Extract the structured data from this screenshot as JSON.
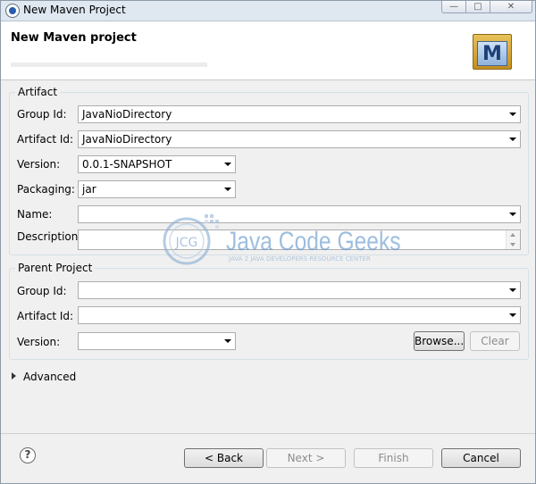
{
  "window": {
    "title": "New Maven Project"
  },
  "banner": {
    "title": "New Maven project",
    "icon_letter": "M"
  },
  "artifact": {
    "legend": "Artifact",
    "group_id": {
      "label": "Group Id:",
      "value": "JavaNioDirectory"
    },
    "artifact_id": {
      "label": "Artifact Id:",
      "value": "JavaNioDirectory"
    },
    "version": {
      "label": "Version:",
      "value": "0.0.1-SNAPSHOT"
    },
    "packaging": {
      "label": "Packaging:",
      "value": "jar"
    },
    "name": {
      "label": "Name:",
      "value": ""
    },
    "description": {
      "label": "Description:",
      "value": ""
    }
  },
  "parent": {
    "legend": "Parent Project",
    "group_id": {
      "label": "Group Id:",
      "value": ""
    },
    "artifact_id": {
      "label": "Artifact Id:",
      "value": ""
    },
    "version": {
      "label": "Version:",
      "value": ""
    },
    "browse_label": "Browse...",
    "clear_label": "Clear"
  },
  "advanced": {
    "label": "Advanced"
  },
  "footer": {
    "help_icon": "?",
    "back_label": "< Back",
    "next_label": "Next >",
    "finish_label": "Finish",
    "cancel_label": "Cancel"
  },
  "watermark": {
    "logo": "JCG",
    "text": "Java Code Geeks",
    "subtext": "JAVA 2 JAVA DEVELOPERS RESOURCE CENTER"
  },
  "colors": {
    "accent": "#2a5cae",
    "watermark": "#6a9ccf"
  }
}
